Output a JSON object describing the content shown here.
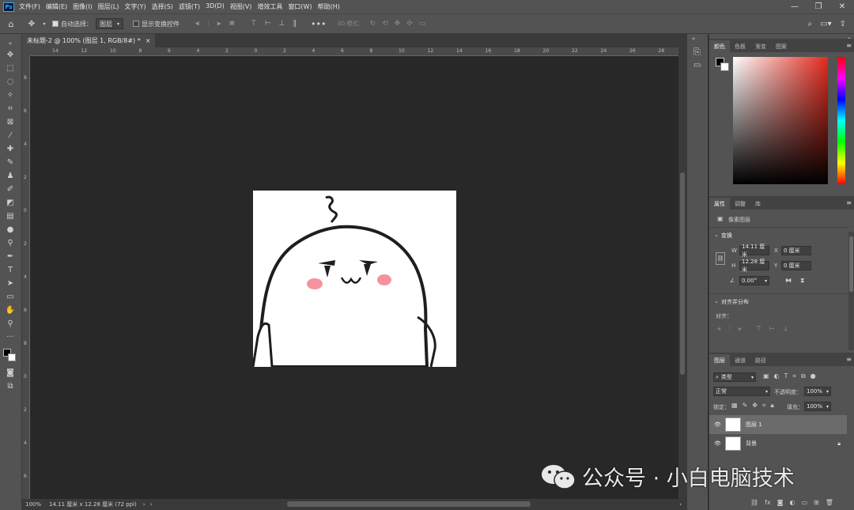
{
  "app": {
    "logo": "Ps"
  },
  "menu": [
    "文件(F)",
    "编辑(E)",
    "图像(I)",
    "图层(L)",
    "文字(Y)",
    "选择(S)",
    "滤镜(T)",
    "3D(D)",
    "视图(V)",
    "增效工具",
    "窗口(W)",
    "帮助(H)"
  ],
  "window_controls": {
    "minimize": "—",
    "restore": "❐",
    "close": "✕"
  },
  "options": {
    "auto_select_label": "自动选择：",
    "auto_select_value": "图层",
    "show_transform_label": "显示变换控件",
    "mode_3d": "3D 模式："
  },
  "document": {
    "tab_title": "未标题-2 @ 100% (图层 1, RGB/8#) *",
    "tab_close": "×",
    "zoom": "100%",
    "doc_info": "14.11 厘米 x 12.28 厘米 (72 ppi)"
  },
  "ruler": {
    "h_ticks": [
      "14",
      "12",
      "10",
      "8",
      "6",
      "4",
      "2",
      "0",
      "2",
      "4",
      "6",
      "8",
      "10",
      "12",
      "14",
      "16",
      "18",
      "20",
      "22",
      "24",
      "26",
      "28"
    ],
    "v_ticks": [
      "8",
      "6",
      "4",
      "2",
      "0",
      "2",
      "4",
      "6",
      "8",
      "0",
      "2",
      "4",
      "6"
    ]
  },
  "color_panel": {
    "tabs": [
      "颜色",
      "色板",
      "渐变",
      "图案"
    ]
  },
  "properties_panel": {
    "tabs": [
      "属性",
      "调整",
      "库"
    ],
    "layer_type": "像素图层",
    "transform_title": "变换",
    "w_label": "W",
    "w_value": "14.11 厘米",
    "x_label": "X",
    "x_value": "0 厘米",
    "h_label": "H",
    "h_value": "12.28 厘米",
    "y_label": "Y",
    "y_value": "0 厘米",
    "angle_value": "0.00°",
    "align_title": "对齐并分布",
    "align_label": "对齐："
  },
  "layers_panel": {
    "tabs": [
      "图层",
      "通道",
      "路径"
    ],
    "filter_kind": "类型",
    "blend_mode": "正常",
    "opacity_label": "不透明度：",
    "opacity_value": "100%",
    "lock_label": "锁定：",
    "fill_label": "填充：",
    "fill_value": "100%",
    "layers": [
      {
        "name": "图层 1",
        "selected": true
      },
      {
        "name": "背景",
        "selected": false,
        "locked": true
      }
    ]
  },
  "watermark": {
    "text": "公众号 · 小白电脑技术"
  },
  "colors": {
    "accent": "#2fa3ff",
    "panel": "#535353",
    "canvas_bg": "#282828"
  }
}
